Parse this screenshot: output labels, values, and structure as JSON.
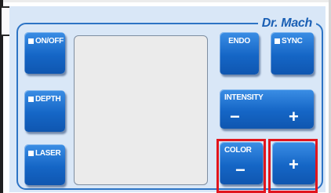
{
  "brand": "Dr. Mach",
  "buttons": {
    "on_off": "ON/OFF",
    "depth": "DEPTH",
    "laser": "LASER",
    "endo": "ENDO",
    "sync": "SYNC",
    "intensity": {
      "label": "INTENSITY",
      "minus": "−",
      "plus": "+"
    },
    "color": {
      "label": "COLOR",
      "minus": "−"
    },
    "color_plus": "+"
  },
  "colors": {
    "panel": "#d9e7f7",
    "button": "#1566c6",
    "frame": "#2d74c5",
    "highlight": "#e1151d"
  }
}
